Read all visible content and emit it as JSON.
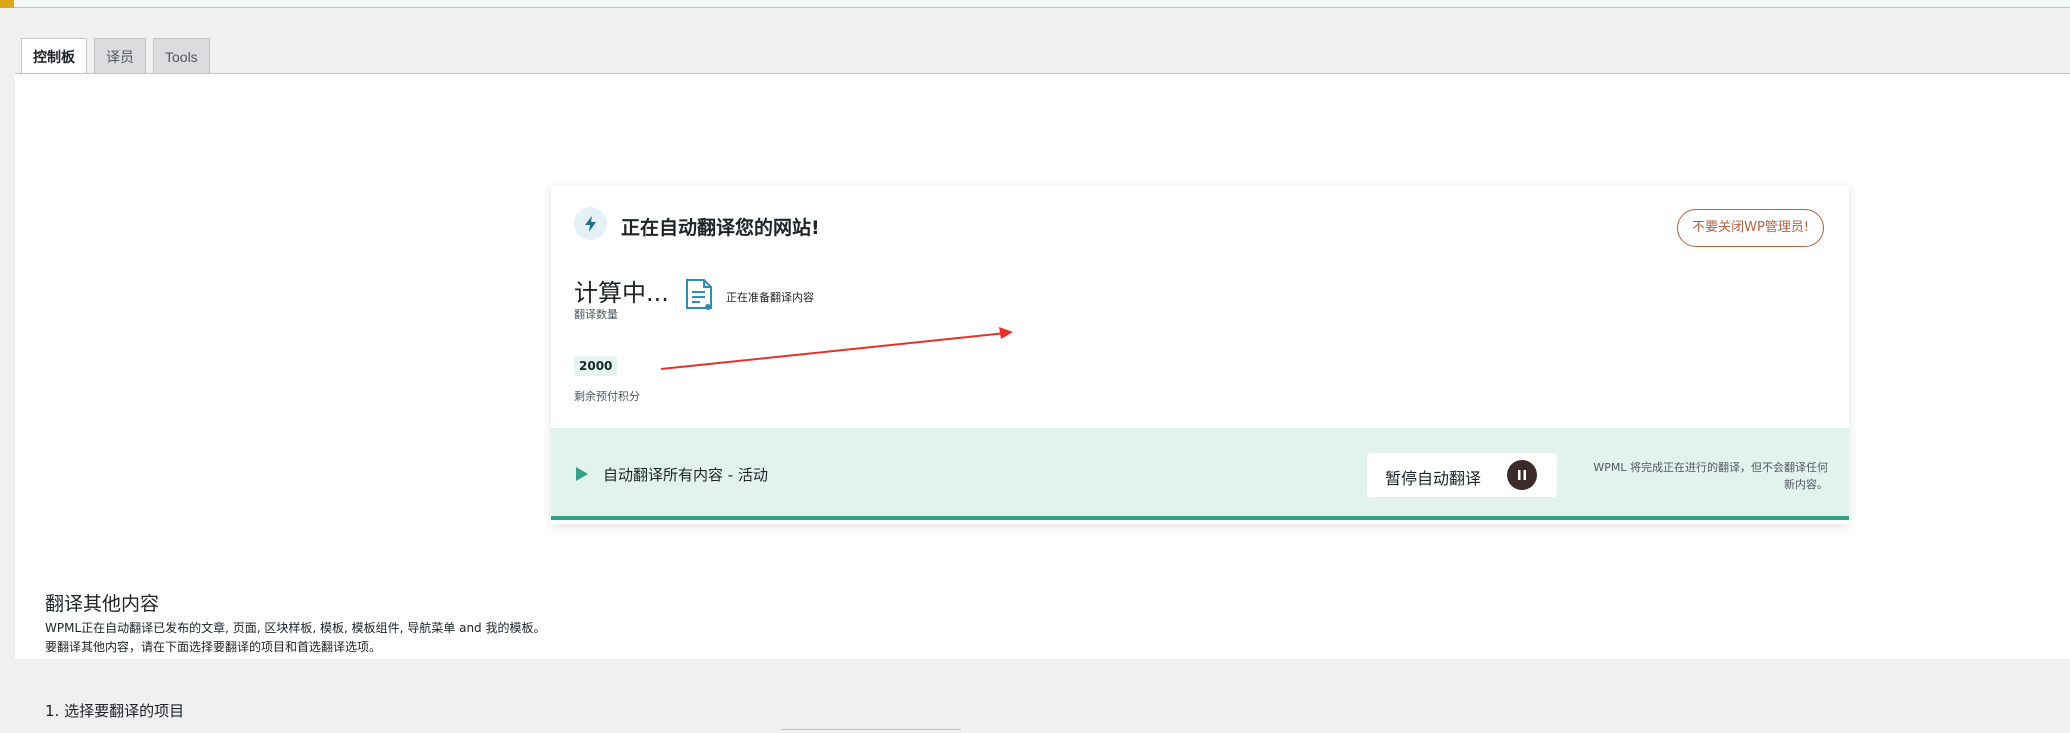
{
  "tabs": [
    {
      "label": "控制板",
      "active": true
    },
    {
      "label": "译员",
      "active": false
    },
    {
      "label": "Tools",
      "active": false
    }
  ],
  "card": {
    "title": "正在自动翻译您的网站!",
    "warning_button": "不要关闭WP管理员!",
    "count_value": "计算中...",
    "count_label": "翻译数量",
    "preparing_text": "正在准备翻译内容",
    "credits_value": "2000",
    "credits_label": "剩余预付积分",
    "bar_status": "自动翻译所有内容 - 活动",
    "pause_button": "暂停自动翻译",
    "bar_note_line1": "WPML 将完成正在进行的翻译，但不会翻译任何",
    "bar_note_line2": "新内容。"
  },
  "section": {
    "title": "翻译其他内容",
    "desc_line1": "WPML正在自动翻译已发布的文章, 页面, 区块样板, 模板, 模板组件, 导航菜单 and 我的模板。",
    "desc_line2": "要翻译其他内容，请在下面选择要翻译的项目和首选翻译选项。",
    "step1": "1. 选择要翻译的项目"
  },
  "colors": {
    "accent_teal": "#33a188",
    "bar_bg": "#e2f3ee",
    "warning": "#b95f3f",
    "annotation_arrow": "#e8302a"
  },
  "icons": [
    "lightning-icon",
    "document-icon",
    "play-icon",
    "pause-icon"
  ]
}
